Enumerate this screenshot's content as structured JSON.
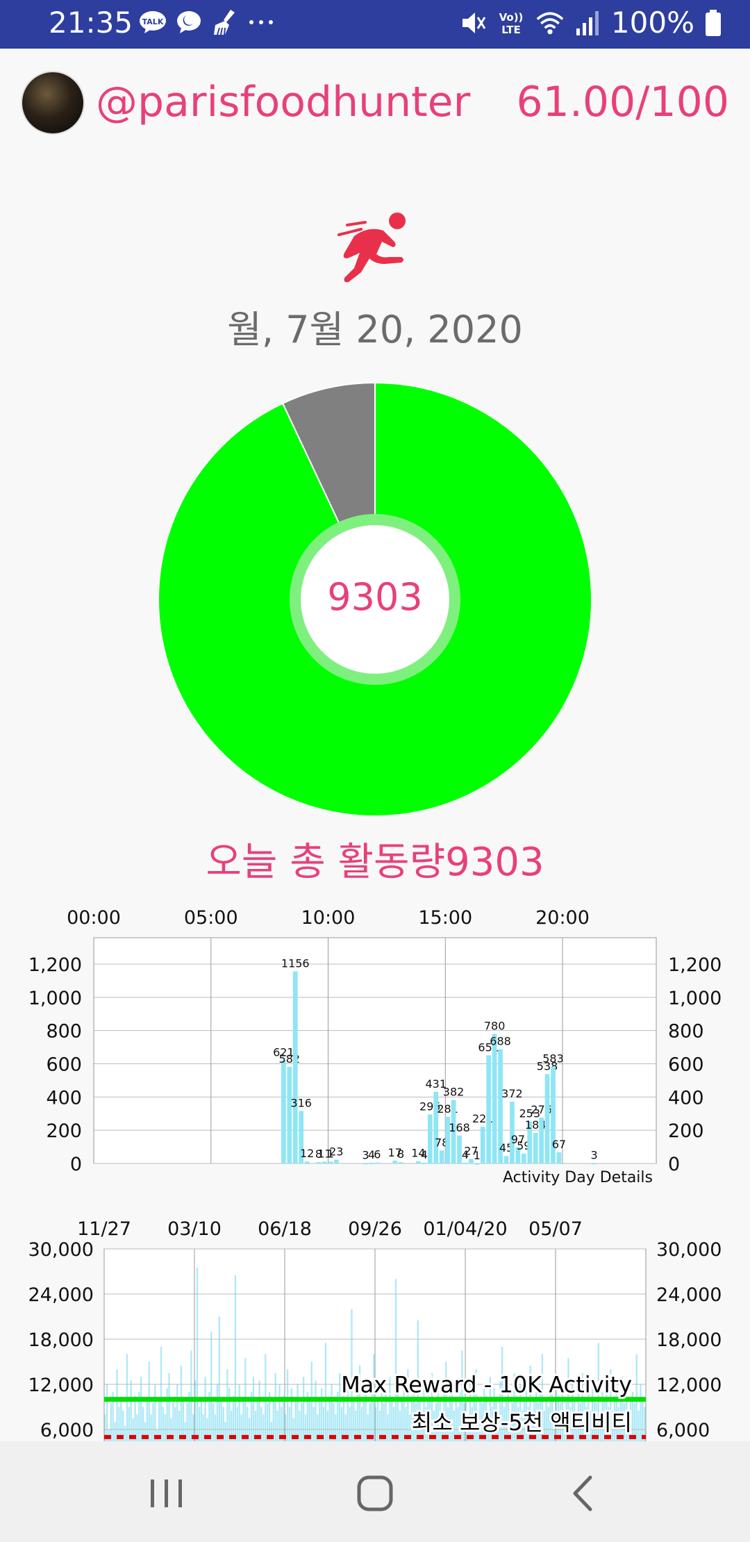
{
  "status_bar": {
    "time": "21:35",
    "left_icons": [
      "talk-icon",
      "chat-bubble-icon",
      "broom-icon",
      "more-dots-icon"
    ],
    "battery_text": "100%",
    "right_icons": [
      "mute-icon",
      "volte-icon",
      "wifi-icon",
      "signal-icon",
      "battery-icon"
    ],
    "volte_label": "Vo)) LTE"
  },
  "header": {
    "username": "@parisfoodhunter",
    "score": "61.00/100"
  },
  "activity": {
    "date": "월, 7월 20, 2020",
    "donut_value": "9303",
    "total_label": "오늘 총 활동량9303",
    "donut_fraction": 0.93,
    "colors": {
      "active": "#00ff00",
      "remaining": "#808080",
      "inner_ring": "#7ef07e",
      "accent": "#e8407a"
    }
  },
  "chart_data": [
    {
      "type": "bar",
      "title": "",
      "annotation": "Activity Day Details",
      "x_ticks": [
        "00:00",
        "05:00",
        "10:00",
        "15:00",
        "20:00"
      ],
      "x_range": [
        0,
        24
      ],
      "y_ticks": [
        "1,200",
        "1,000",
        "800",
        "600",
        "400",
        "200",
        "0"
      ],
      "ylim": [
        0,
        1200
      ],
      "grid": true,
      "bar_color": "#8ee6f5",
      "bars": [
        {
          "h": 8.0,
          "v": 621,
          "label": "621"
        },
        {
          "h": 8.25,
          "v": 582,
          "label": "582"
        },
        {
          "h": 8.5,
          "v": 1156,
          "label": "1156"
        },
        {
          "h": 8.75,
          "v": 316,
          "label": "316"
        },
        {
          "h": 9.0,
          "v": 12,
          "label": "12"
        },
        {
          "h": 9.5,
          "v": 8,
          "label": "8"
        },
        {
          "h": 9.75,
          "v": 11,
          "label": "11"
        },
        {
          "h": 10.0,
          "v": 11,
          "label": "1"
        },
        {
          "h": 10.25,
          "v": 23,
          "label": "23"
        },
        {
          "h": 11.5,
          "v": 3,
          "label": "3"
        },
        {
          "h": 11.75,
          "v": 4,
          "label": "4"
        },
        {
          "h": 12.0,
          "v": 6,
          "label": "6"
        },
        {
          "h": 12.75,
          "v": 17,
          "label": "17"
        },
        {
          "h": 13.0,
          "v": 8,
          "label": "8"
        },
        {
          "h": 13.75,
          "v": 14,
          "label": "14"
        },
        {
          "h": 14.0,
          "v": 4,
          "label": "4"
        },
        {
          "h": 14.25,
          "v": 295,
          "label": "295"
        },
        {
          "h": 14.5,
          "v": 431,
          "label": "431"
        },
        {
          "h": 14.75,
          "v": 78,
          "label": "78"
        },
        {
          "h": 15.0,
          "v": 281,
          "label": "281"
        },
        {
          "h": 15.25,
          "v": 382,
          "label": "382"
        },
        {
          "h": 15.5,
          "v": 168,
          "label": "168"
        },
        {
          "h": 15.75,
          "v": 4,
          "label": "4"
        },
        {
          "h": 16.0,
          "v": 27,
          "label": "27"
        },
        {
          "h": 16.25,
          "v": 1,
          "label": "1"
        },
        {
          "h": 16.5,
          "v": 221,
          "label": "221"
        },
        {
          "h": 16.75,
          "v": 651,
          "label": "651"
        },
        {
          "h": 17.0,
          "v": 780,
          "label": "780"
        },
        {
          "h": 17.25,
          "v": 688,
          "label": "688"
        },
        {
          "h": 17.5,
          "v": 45,
          "label": "45"
        },
        {
          "h": 17.75,
          "v": 372,
          "label": "372"
        },
        {
          "h": 18.0,
          "v": 97,
          "label": "97"
        },
        {
          "h": 18.25,
          "v": 59,
          "label": "59"
        },
        {
          "h": 18.5,
          "v": 253,
          "label": "253"
        },
        {
          "h": 18.75,
          "v": 184,
          "label": "184"
        },
        {
          "h": 19.0,
          "v": 276,
          "label": "276"
        },
        {
          "h": 19.25,
          "v": 538,
          "label": "538"
        },
        {
          "h": 19.5,
          "v": 583,
          "label": "583"
        },
        {
          "h": 19.75,
          "v": 67,
          "label": "67"
        },
        {
          "h": 21.25,
          "v": 3,
          "label": "3"
        }
      ]
    },
    {
      "type": "bar",
      "title": "",
      "x_ticks": [
        "11/27",
        "03/10",
        "06/18",
        "09/26",
        "01/04/20",
        "05/07"
      ],
      "y_ticks": [
        "30,000",
        "24,000",
        "18,000",
        "12,000",
        "6,000"
      ],
      "ylim": [
        0,
        30000
      ],
      "grid": true,
      "bar_color": "#aee9f7",
      "reference_lines": [
        {
          "label": "Max Reward - 10K Activity",
          "value": 10000,
          "color": "#00e000",
          "style": "solid"
        },
        {
          "label": "최소 보상-5천 액티비티",
          "value": 5000,
          "color": "#e00000",
          "style": "dashed"
        }
      ],
      "daily_values": [
        8000,
        12000,
        6000,
        9500,
        11000,
        7000,
        14000,
        9000,
        10000,
        8500,
        6500,
        16000,
        9000,
        12500,
        7500,
        10500,
        8000,
        11000,
        13000,
        9000,
        7000,
        10000,
        15000,
        8000,
        9500,
        12000,
        6000,
        10000,
        17000,
        9000,
        8000,
        11500,
        13500,
        7500,
        10000,
        9000,
        12000,
        8500,
        14500,
        10000,
        7000,
        9500,
        11000,
        16500,
        8000,
        12500,
        27500,
        9000,
        10000,
        8000,
        13000,
        7500,
        11000,
        19000,
        9500,
        8000,
        12000,
        21000,
        10000,
        9000,
        7000,
        14000,
        11500,
        8500,
        10500,
        26500,
        9000,
        12000,
        8000,
        10000,
        15500,
        9000,
        7500,
        11000,
        13000,
        8500,
        10000,
        12500,
        9000,
        8000,
        16000,
        9500,
        11000,
        7000,
        10000,
        13500,
        8500,
        12000,
        9000,
        10500,
        8000,
        14000,
        9000,
        11500,
        7500,
        10000,
        12000,
        8500,
        9500,
        13000,
        8000,
        11000,
        10000,
        15000,
        9000,
        12500,
        8000,
        10000,
        11500,
        9000,
        17500,
        8500,
        10000,
        12000,
        9500,
        8000,
        11000,
        13500,
        9000,
        10500,
        8000,
        12000,
        9000,
        22000,
        10000,
        8500,
        11000,
        14500,
        9000,
        10000,
        12500,
        8000,
        9500,
        11000,
        16000,
        9000,
        10000,
        8500,
        12000,
        9500,
        11000,
        8000,
        13000,
        10000,
        9000,
        26000,
        11500,
        8500,
        10000,
        12000,
        9000,
        14000,
        8000,
        10500,
        11000,
        9500,
        20500,
        10000,
        8500,
        12000,
        9000,
        11000,
        10000,
        13500,
        8500,
        9500,
        12000,
        10000,
        8000,
        11500,
        15000,
        9000,
        10500,
        12500,
        8500,
        10000,
        9000,
        11000,
        16500,
        9500,
        10000,
        8000,
        12000,
        9000,
        11000,
        14000,
        8500,
        10000,
        9500,
        12000,
        10500,
        8000,
        13000,
        9000,
        11500,
        10000,
        8500,
        12500,
        17000,
        9000,
        10000,
        11000,
        8000,
        9500,
        13500,
        10500,
        9000,
        12000,
        8500,
        10000,
        11500,
        9000,
        14500,
        8000,
        10000,
        12000,
        9500,
        11000,
        16000,
        8500,
        10000,
        9000,
        12000,
        11000,
        8000,
        13000,
        10500,
        9500,
        11500,
        8500,
        10000,
        15500,
        9000,
        12000,
        10000,
        8000,
        11000,
        9500,
        13500,
        10000,
        9000,
        11000,
        8500,
        12500,
        10000,
        9500,
        17500,
        8000,
        11000,
        10000,
        12000,
        9000,
        14000,
        8500,
        10500,
        11500,
        9000,
        10000,
        13000,
        9500,
        12000,
        8000,
        10000,
        11000,
        9500,
        16000,
        8500,
        12000,
        10000,
        9000
      ]
    }
  ],
  "nav_bar": {
    "icons": [
      "recent-apps-icon",
      "home-icon",
      "back-icon"
    ]
  }
}
